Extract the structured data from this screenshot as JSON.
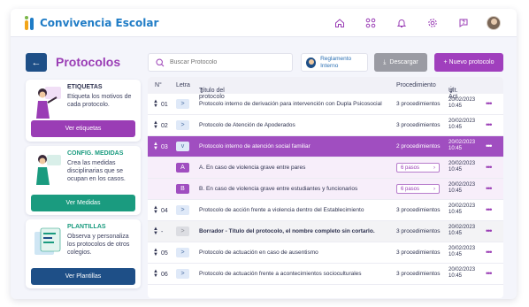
{
  "app": {
    "name": "Convivencia Escolar"
  },
  "topbar": {
    "icons": [
      "home-icon",
      "grid-icon",
      "bell-icon",
      "gear-icon",
      "help-icon",
      "user-avatar"
    ]
  },
  "page": {
    "title": "Protocolos",
    "back_icon": "arrow-left-icon"
  },
  "sidebar": {
    "cards": [
      {
        "title": "ETIQUETAS",
        "description": "Etiqueta los motivos de cada protocolo.",
        "button": "Ver etiquetas",
        "accent": "#9a3db5",
        "button_color": "#9a3db5"
      },
      {
        "title": "CONFIG. MEDIDAS",
        "description": "Crea las medidas disciplinarias que se ocupan en los casos.",
        "button": "Ver Medidas",
        "accent": "#1a9b7f",
        "button_color": "#1a9b7f"
      },
      {
        "title": "PLANTILLAS",
        "description": "Observa y personaliza los protocolos de otros colegios.",
        "button": "Ver Plantillas",
        "accent": "#1a9b7f",
        "button_color": "#1e4f87"
      }
    ]
  },
  "toolbar": {
    "search_placeholder": "Buscar Protocolo",
    "reglamento_label": "Reglamento Interno",
    "download_label": "Descargar",
    "new_label": "+  Nuevo protocolo"
  },
  "table": {
    "headers": {
      "num": "N°",
      "letter": "Letra",
      "title": "Título del protocolo",
      "proc": "Procedimiento",
      "date": "Últ. Act"
    },
    "rows": [
      {
        "num": "01",
        "letter": ">",
        "title": "Protocolo interno de derivación para intervención con Dupla Psicosocial",
        "proc": "3 procedimientos",
        "date": "20/02/2023",
        "time": "10:45",
        "state": "normal"
      },
      {
        "num": "02",
        "letter": ">",
        "title": "Protocolo de Atención de Apoderados",
        "proc": "3 procedimientos",
        "date": "20/02/2023",
        "time": "10:45",
        "state": "normal"
      },
      {
        "num": "03",
        "letter": "v",
        "title": "Protocolo interno de atención social familiar",
        "proc": "2 procedimientos",
        "date": "20/02/2023",
        "time": "10:45",
        "state": "selected"
      },
      {
        "num": "",
        "letter": "A",
        "title": "A. En caso de violencia grave entre pares",
        "proc": "6 pasos",
        "date": "20/02/2023",
        "time": "10:45",
        "state": "sub"
      },
      {
        "num": "",
        "letter": "B",
        "title": "B. En caso de violencia grave entre estudiantes y funcionarios",
        "proc": "6 pasos",
        "date": "20/02/2023",
        "time": "10:45",
        "state": "sub"
      },
      {
        "num": "04",
        "letter": ">",
        "title": "Protocolo de acción frente a violencia dentro del Establecimiento",
        "proc": "3 procedimientos",
        "date": "20/02/2023",
        "time": "10:45",
        "state": "normal"
      },
      {
        "num": "-",
        "letter": ">",
        "title": "Borrador - Título del protocolo, el nombre completo sin cortarlo.",
        "proc": "3 procedimientos",
        "date": "20/02/2023",
        "time": "10:45",
        "state": "draft"
      },
      {
        "num": "05",
        "letter": ">",
        "title": "Protocolo de actuación en caso de ausentismo",
        "proc": "3 procedimientos",
        "date": "20/02/2023",
        "time": "10:45",
        "state": "normal"
      },
      {
        "num": "06",
        "letter": ">",
        "title": "Protocolo de actuación frente a acontecimientos socioculturales",
        "proc": "3 procedimientos",
        "date": "20/02/2023",
        "time": "10:45",
        "state": "normal"
      }
    ]
  },
  "colors": {
    "primary": "#a03fbd",
    "navy": "#1e4f87",
    "teal": "#1a9b7f"
  }
}
